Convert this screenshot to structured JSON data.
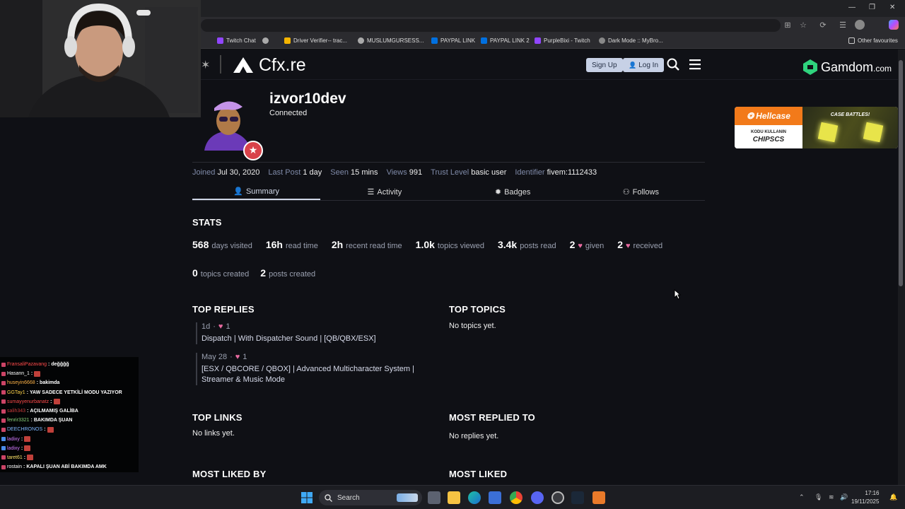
{
  "browser": {
    "bookmarks": [
      {
        "label": "Twitch Chat",
        "color": "#9146ff"
      },
      {
        "label": "",
        "color": "#aaaaaa"
      },
      {
        "label": "Driver Verifier-- trac...",
        "color": "#f4b400"
      },
      {
        "label": "MUSLUMGURSESS...",
        "color": "#aaaaaa"
      },
      {
        "label": "PAYPAL LINK",
        "color": "#0070e0"
      },
      {
        "label": "PAYPAL LINK 2",
        "color": "#0070e0"
      },
      {
        "label": "PurpleBixi - Twitch",
        "color": "#9146ff"
      },
      {
        "label": "Dark Mode :: MyBro...",
        "color": "#888888"
      }
    ],
    "other_favourites": "Other favourites"
  },
  "header": {
    "logo_text": "Cfx.re",
    "signup_label": "Sign Up",
    "login_label": "Log In",
    "gamdom_text": "Gamdom",
    "gamdom_suffix": ".com"
  },
  "profile": {
    "username": "izvor10dev",
    "status": "Connected",
    "meta": [
      {
        "key": "Joined",
        "value": "Jul 30, 2020"
      },
      {
        "key": "Last Post",
        "value": "1 day"
      },
      {
        "key": "Seen",
        "value": "15 mins"
      },
      {
        "key": "Views",
        "value": "991"
      },
      {
        "key": "Trust Level",
        "value": "basic user"
      },
      {
        "key": "Identifier",
        "value": "fivem:1112433"
      }
    ],
    "tabs": [
      {
        "label": "Summary",
        "icon": "user-icon"
      },
      {
        "label": "Activity",
        "icon": "list-icon"
      },
      {
        "label": "Badges",
        "icon": "badge-icon"
      },
      {
        "label": "Follows",
        "icon": "users-icon"
      }
    ]
  },
  "stats": {
    "title": "STATS",
    "row1": [
      {
        "value": "568",
        "label": "days visited"
      },
      {
        "value": "16h",
        "label": "read time"
      },
      {
        "value": "2h",
        "label": "recent read time"
      },
      {
        "value": "1.0k",
        "label": "topics viewed"
      },
      {
        "value": "3.4k",
        "label": "posts read"
      },
      {
        "value": "2",
        "label": "given"
      },
      {
        "value": "2",
        "label": "received"
      }
    ],
    "row2": [
      {
        "value": "0",
        "label": "topics created"
      },
      {
        "value": "2",
        "label": "posts created"
      }
    ]
  },
  "top_replies": {
    "title": "TOP REPLIES",
    "items": [
      {
        "date": "1d",
        "likes": "1",
        "title": "Dispatch | With Dispatcher Sound | [QB/QBX/ESX]"
      },
      {
        "date": "May 28",
        "likes": "1",
        "title": "[ESX / QBCORE / QBOX] | Advanced Multicharacter System | Streamer & Music Mode"
      }
    ]
  },
  "top_topics": {
    "title": "TOP TOPICS",
    "empty": "No topics yet."
  },
  "top_links": {
    "title": "TOP LINKS",
    "empty": "No links yet."
  },
  "most_replied": {
    "title": "MOST REPLIED TO",
    "empty": "No replies yet."
  },
  "most_liked_by": {
    "title": "MOST LIKED BY"
  },
  "most_liked": {
    "title": "MOST LIKED"
  },
  "ad": {
    "brand": "Hellcase",
    "line1": "KODU KULLANIN",
    "code": "CHIPSCS",
    "right_text": "CASE BATTLES!"
  },
  "chat": [
    {
      "user": "FransaliPazavang",
      "color": "#ff4a4a",
      "msg": "değğğğ",
      "emote": false
    },
    {
      "user": "Hasann_1",
      "color": "#ffffff",
      "msg": "",
      "emote": true
    },
    {
      "user": "huseyin6668",
      "color": "#ffb347",
      "msg": "bakimda",
      "emote": false
    },
    {
      "user": "GGTay1",
      "color": "#ffd34a",
      "msg": "YAW SADECE YETKİLİ MODU YAZIYOR",
      "emote": false
    },
    {
      "user": "sumayyenurbanatz",
      "color": "#ff4a4a",
      "msg": "",
      "emote": true
    },
    {
      "user": "salih343",
      "color": "#c93a3a",
      "msg": "AÇILMAMIŞ GALİBA",
      "emote": false
    },
    {
      "user": "fenrir3321",
      "color": "#8ad37a",
      "msg": "BAKIMDA ŞUAN",
      "emote": false
    },
    {
      "user": "DEECHRONOS",
      "color": "#7fb7ff",
      "msg": "",
      "emote": true
    },
    {
      "user": "ladixy",
      "color": "#d47aff",
      "msg": "",
      "emote": true
    },
    {
      "user": "ladixy",
      "color": "#d47aff",
      "msg": "",
      "emote": true
    },
    {
      "user": "taret61",
      "color": "#ffe46a",
      "msg": "",
      "emote": true
    },
    {
      "user": "rostain",
      "color": "#ffffff",
      "msg": "KAPALI ŞUAN ABİ BAKIMDA AMK",
      "emote": false
    }
  ],
  "taskbar": {
    "search_label": "Search",
    "time": "17:16",
    "date": "19/11/2025"
  }
}
